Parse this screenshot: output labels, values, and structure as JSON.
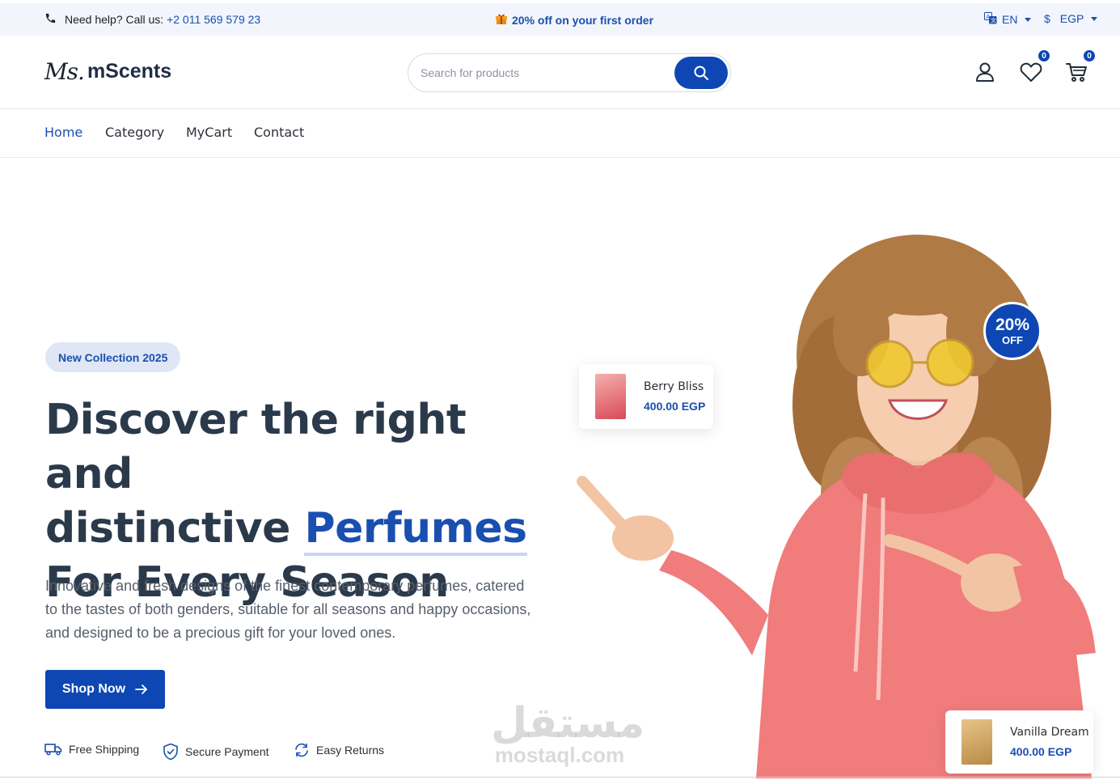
{
  "topbar": {
    "help_label": "Need help? Call us:",
    "phone": "+2 011 569 579 23",
    "promo": "20% off on your first order",
    "language": "EN",
    "currency_symbol": "$",
    "currency": "EGP"
  },
  "header": {
    "logo_script": "Ms.",
    "logo_name": "mScents",
    "search_placeholder": "Search for products",
    "wishlist_count": "0",
    "cart_count": "0"
  },
  "nav": {
    "items": [
      "Home",
      "Category",
      "MyCart",
      "Contact"
    ]
  },
  "hero": {
    "badge": "New Collection 2025",
    "title_line1": "Discover the right and",
    "title_line2_prefix": "distinctive ",
    "title_accent": "Perfumes",
    "title_line3": "For Every Season",
    "description": "Innovative and fresh designs of the finest contemporary perfumes, catered to the tastes of both genders, suitable for all seasons and happy occasions, and designed to be a precious gift for your loved ones.",
    "cta": "Shop Now",
    "features": [
      "Free Shipping",
      "Secure Payment",
      "Easy Returns"
    ],
    "offer_pct": "20%",
    "offer_label": "OFF"
  },
  "products": [
    {
      "name": "Berry Bliss",
      "price": "400.00 EGP"
    },
    {
      "name": "Vanilla Dream",
      "price": "400.00 EGP"
    }
  ],
  "watermark": {
    "arabic": "مستقل",
    "latin": "mostaql.com"
  },
  "colors": {
    "brand": "#0e47b3",
    "accent_text": "#1a4fb0",
    "heading": "#2a3a4b",
    "hoodie": "#f07c7c"
  }
}
